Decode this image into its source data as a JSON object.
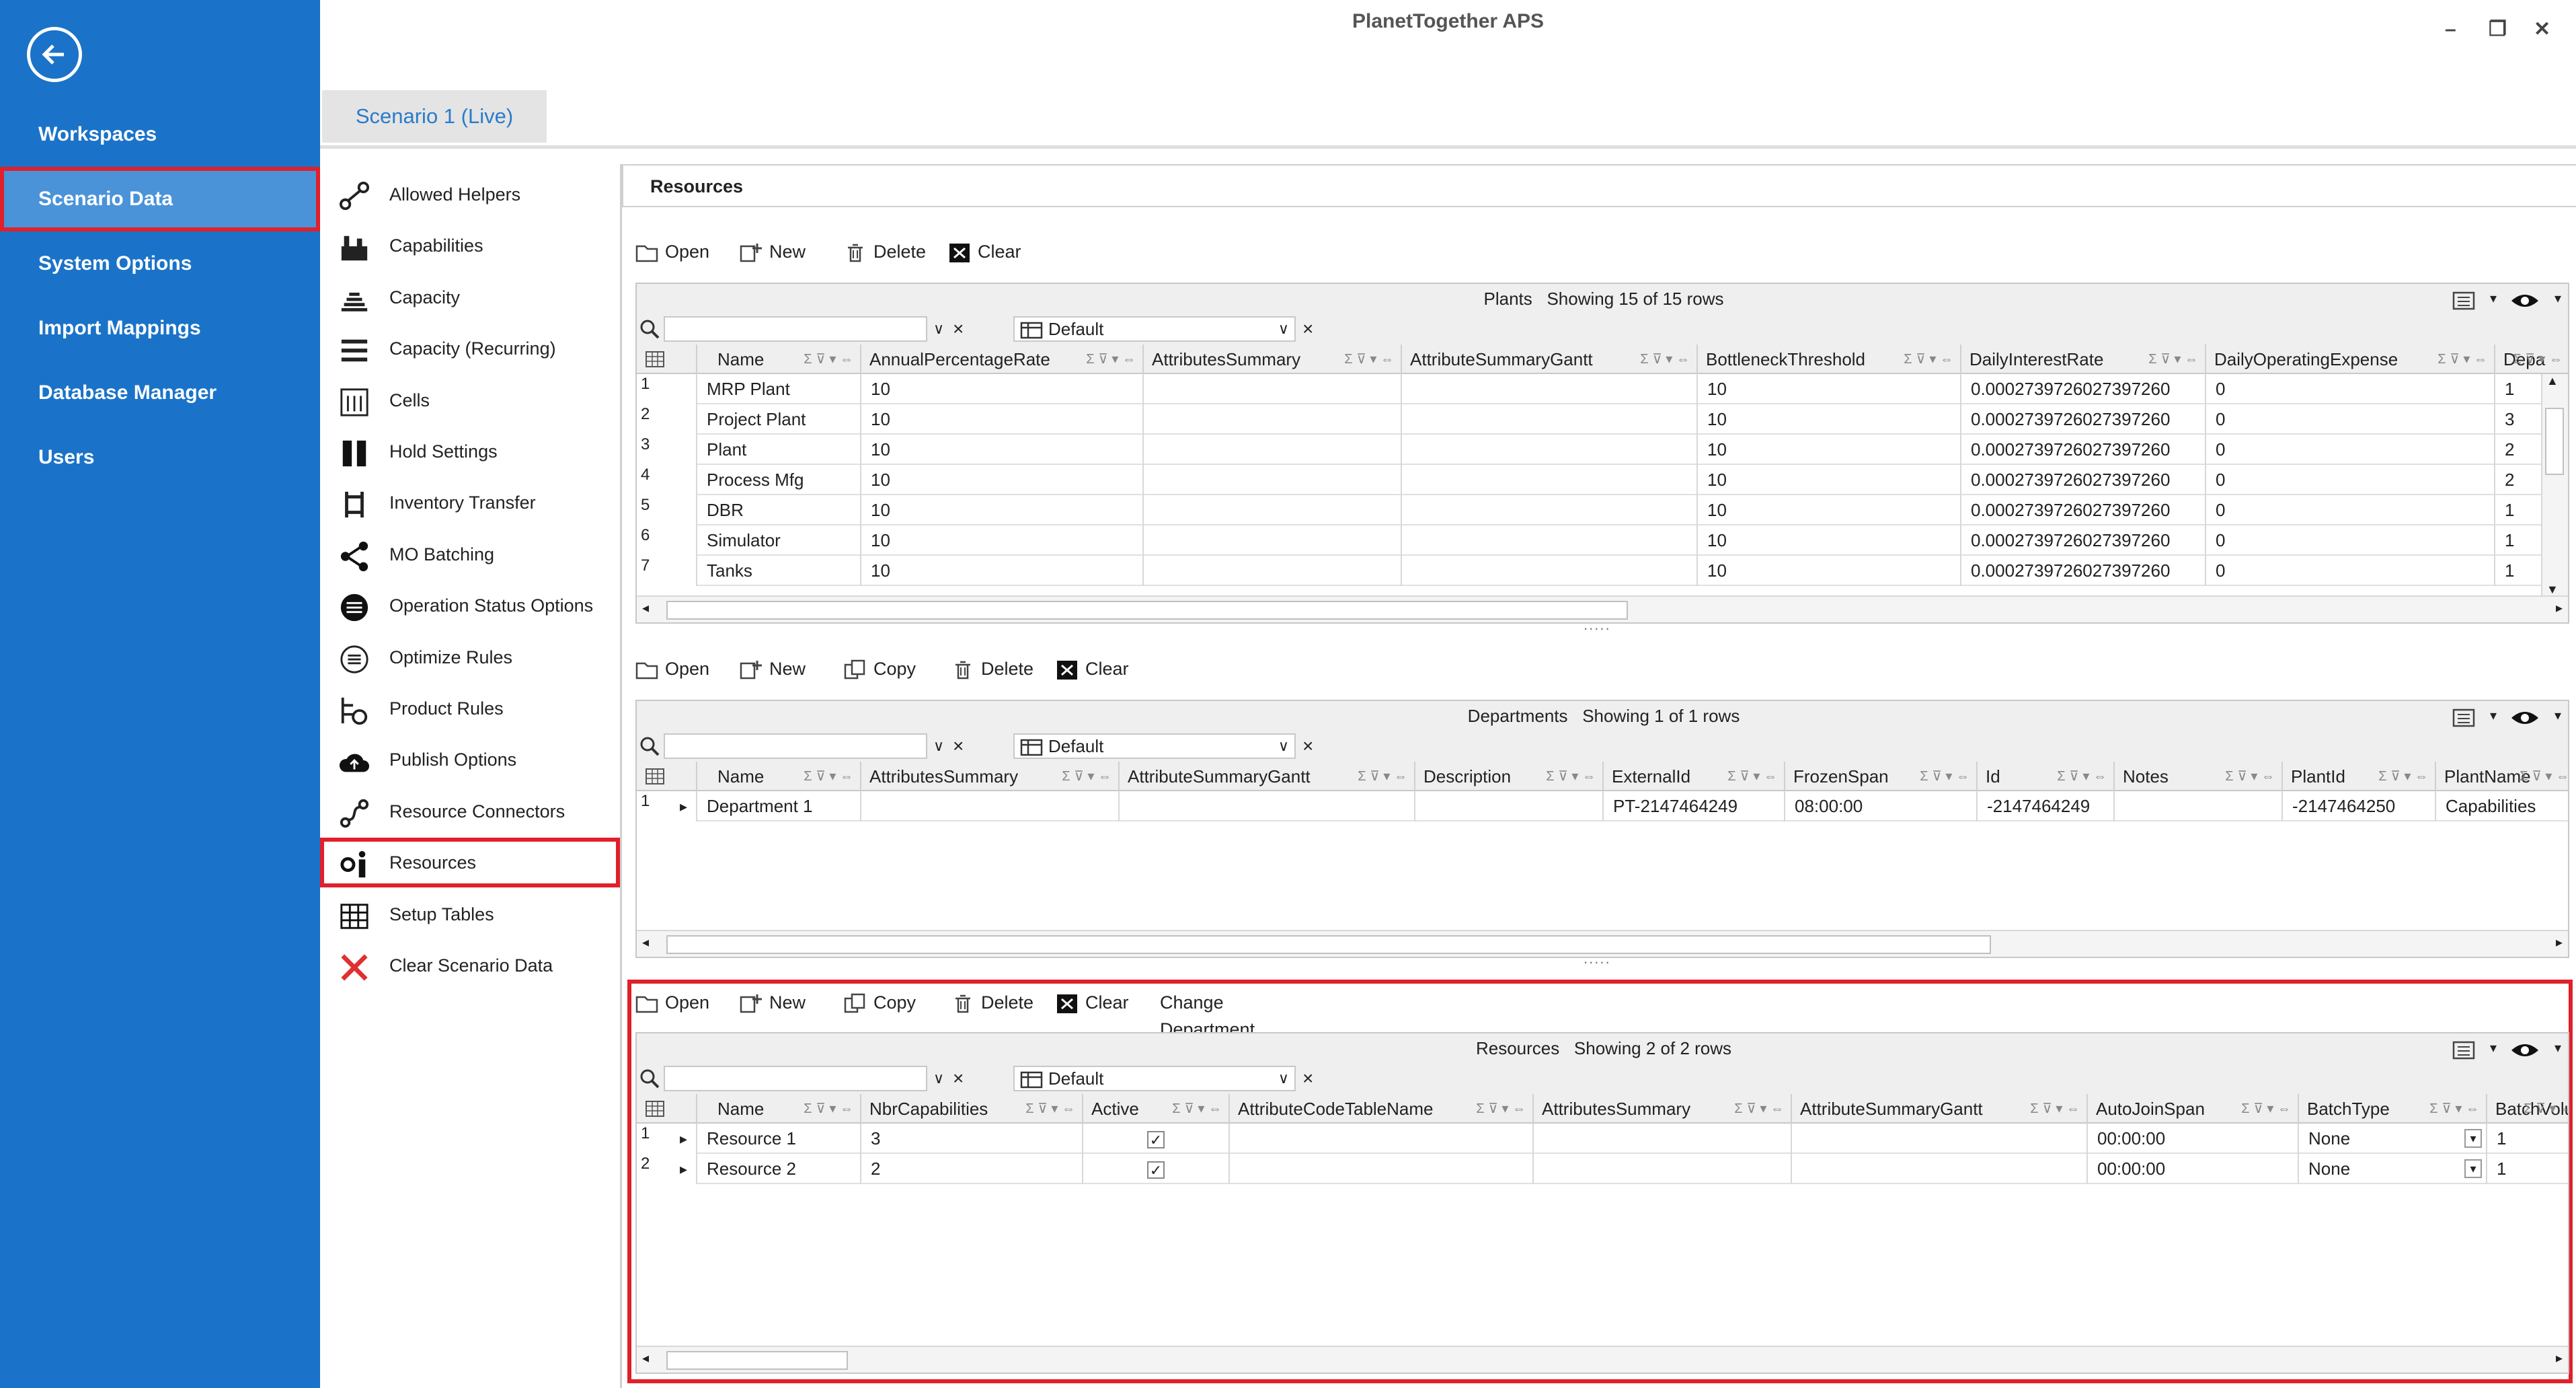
{
  "app_title": "PlanetTogether APS",
  "window_controls": {
    "min": "–",
    "max": "❐",
    "close": "✕"
  },
  "left_nav": [
    {
      "label": "Workspaces"
    },
    {
      "label": "Scenario Data",
      "selected": true
    },
    {
      "label": "System Options"
    },
    {
      "label": "Import Mappings"
    },
    {
      "label": "Database Manager"
    },
    {
      "label": "Users"
    }
  ],
  "tab": "Scenario 1 (Live)",
  "categories": [
    {
      "label": "Allowed Helpers",
      "icon": "helpers-icon"
    },
    {
      "label": "Capabilities",
      "icon": "capabilities-icon"
    },
    {
      "label": "Capacity",
      "icon": "capacity-icon"
    },
    {
      "label": "Capacity (Recurring)",
      "icon": "capacity-recurring-icon"
    },
    {
      "label": "Cells",
      "icon": "cells-icon"
    },
    {
      "label": "Hold Settings",
      "icon": "hold-icon"
    },
    {
      "label": "Inventory Transfer",
      "icon": "inventory-transfer-icon"
    },
    {
      "label": "MO Batching",
      "icon": "batching-icon"
    },
    {
      "label": "Operation Status Options",
      "icon": "status-icon"
    },
    {
      "label": "Optimize Rules",
      "icon": "optimize-icon"
    },
    {
      "label": "Product Rules",
      "icon": "product-rules-icon"
    },
    {
      "label": "Publish Options",
      "icon": "publish-icon"
    },
    {
      "label": "Resource Connectors",
      "icon": "connectors-icon"
    },
    {
      "label": "Resources",
      "icon": "resources-icon",
      "selected": true
    },
    {
      "label": "Setup Tables",
      "icon": "table-icon"
    },
    {
      "label": "Clear Scenario Data",
      "icon": "clear-x-icon"
    }
  ],
  "section_title": "Resources",
  "toolbar_labels": {
    "open": "Open",
    "new": "New",
    "copy": "Copy",
    "delete": "Delete",
    "clear": "Clear",
    "change_department": "Change Department"
  },
  "filter_layout": "Default",
  "plants": {
    "name": "Plants",
    "status": "Showing 15 of 15 rows",
    "columns": [
      "Name",
      "AnnualPercentageRate",
      "AttributesSummary",
      "AttributeSummaryGantt",
      "BottleneckThreshold",
      "DailyInterestRate",
      "DailyOperatingExpense",
      "Depa"
    ],
    "rows": [
      {
        "n": "1",
        "c": [
          "MRP Plant",
          "10",
          "",
          "",
          "10",
          "0.0002739726027397260",
          "0",
          "1"
        ]
      },
      {
        "n": "2",
        "c": [
          "Project Plant",
          "10",
          "",
          "",
          "10",
          "0.0002739726027397260",
          "0",
          "3"
        ]
      },
      {
        "n": "3",
        "c": [
          "Plant",
          "10",
          "",
          "",
          "10",
          "0.0002739726027397260",
          "0",
          "2"
        ]
      },
      {
        "n": "4",
        "c": [
          "Process Mfg",
          "10",
          "",
          "",
          "10",
          "0.0002739726027397260",
          "0",
          "2"
        ]
      },
      {
        "n": "5",
        "c": [
          "DBR",
          "10",
          "",
          "",
          "10",
          "0.0002739726027397260",
          "0",
          "1"
        ]
      },
      {
        "n": "6",
        "c": [
          "Simulator",
          "10",
          "",
          "",
          "10",
          "0.0002739726027397260",
          "0",
          "1"
        ]
      },
      {
        "n": "7",
        "c": [
          "Tanks",
          "10",
          "",
          "",
          "10",
          "0.0002739726027397260",
          "0",
          "1"
        ]
      }
    ]
  },
  "departments": {
    "name": "Departments",
    "status": "Showing 1 of 1 rows",
    "columns": [
      "Name",
      "AttributesSummary",
      "AttributeSummaryGantt",
      "Description",
      "ExternalId",
      "FrozenSpan",
      "Id",
      "Notes",
      "PlantId",
      "PlantName"
    ],
    "rows": [
      {
        "n": "1",
        "c": [
          "Department 1",
          "",
          "",
          "",
          "PT-2147464249",
          "08:00:00",
          "-2147464249",
          "",
          "-2147464250",
          "Capabilities"
        ]
      }
    ]
  },
  "resources": {
    "name": "Resources",
    "status": "Showing 2 of 2 rows",
    "columns": [
      "Name",
      "NbrCapabilities",
      "Active",
      "AttributeCodeTableName",
      "AttributesSummary",
      "AttributeSummaryGantt",
      "AutoJoinSpan",
      "BatchType",
      "BatchVolu"
    ],
    "rows": [
      {
        "n": "1",
        "c": [
          "Resource 1",
          "3",
          "✓",
          "",
          "",
          "",
          "00:00:00",
          "None",
          "1"
        ]
      },
      {
        "n": "2",
        "c": [
          "Resource 2",
          "2",
          "✓",
          "",
          "",
          "",
          "00:00:00",
          "None",
          "1"
        ]
      }
    ]
  }
}
